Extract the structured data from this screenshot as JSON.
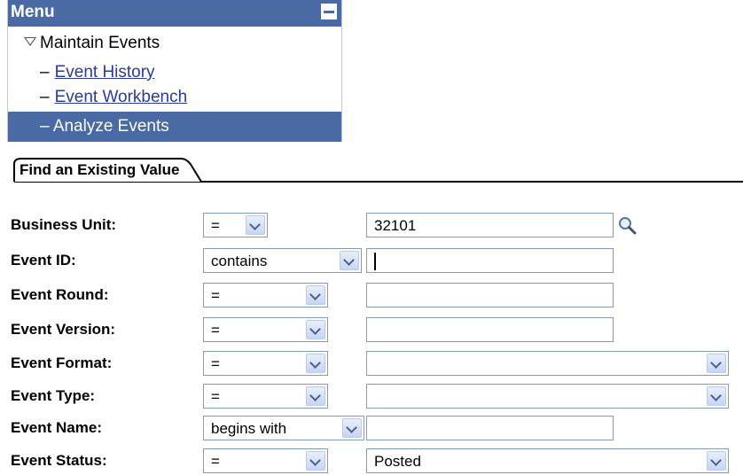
{
  "menu": {
    "title": "Menu",
    "folder": "Maintain Events",
    "items": [
      {
        "dash": "–",
        "label": "Event History"
      },
      {
        "dash": "–",
        "label": "Event Workbench"
      },
      {
        "dash": "–",
        "label": "Analyze Events"
      }
    ]
  },
  "tab": {
    "label": "Find an Existing Value"
  },
  "form": {
    "rows": [
      {
        "label": "Business Unit:",
        "operator": "=",
        "value": "32101"
      },
      {
        "label": "Event ID:",
        "operator": "contains",
        "value": ""
      },
      {
        "label": "Event Round:",
        "operator": "=",
        "value": ""
      },
      {
        "label": "Event Version:",
        "operator": "=",
        "value": ""
      },
      {
        "label": "Event Format:",
        "operator": "=",
        "value": ""
      },
      {
        "label": "Event Type:",
        "operator": "=",
        "value": ""
      },
      {
        "label": "Event Name:",
        "operator": "begins with",
        "value": ""
      },
      {
        "label": "Event Status:",
        "operator": "=",
        "value": "Posted"
      }
    ]
  },
  "colors": {
    "menu_header": "#4a6aa6",
    "link": "#2a3b9b",
    "field_border": "#7f9db9"
  }
}
